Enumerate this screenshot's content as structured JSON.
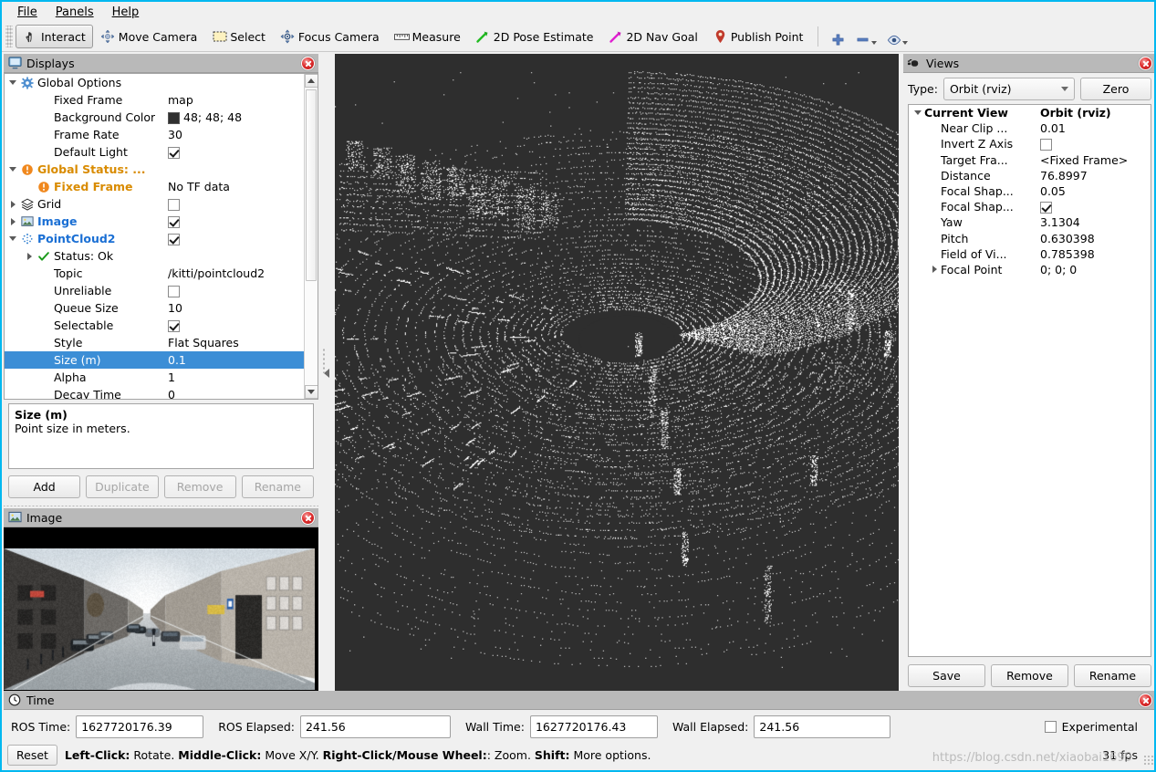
{
  "window": {
    "accent": "#00b8f0"
  },
  "menubar": {
    "items": [
      {
        "name": "file",
        "label": "File",
        "mnemonic": "F"
      },
      {
        "name": "panels",
        "label": "Panels",
        "mnemonic": "P"
      },
      {
        "name": "help",
        "label": "Help",
        "mnemonic": "H"
      }
    ]
  },
  "toolbar": {
    "tools": [
      {
        "name": "interact",
        "label": "Interact",
        "icon": "hand-cursor-icon",
        "active": true
      },
      {
        "name": "move-camera",
        "label": "Move Camera",
        "icon": "move-camera-icon",
        "active": false
      },
      {
        "name": "select",
        "label": "Select",
        "icon": "select-rectangle-icon",
        "active": false
      },
      {
        "name": "focus-camera",
        "label": "Focus Camera",
        "icon": "focus-camera-icon",
        "active": false
      },
      {
        "name": "measure",
        "label": "Measure",
        "icon": "ruler-icon",
        "active": false
      },
      {
        "name": "2d-pose-estimate",
        "label": "2D Pose Estimate",
        "icon": "green-arrow-icon",
        "active": false
      },
      {
        "name": "2d-nav-goal",
        "label": "2D Nav Goal",
        "icon": "magenta-arrow-icon",
        "active": false
      },
      {
        "name": "publish-point",
        "label": "Publish Point",
        "icon": "map-pin-icon",
        "active": false
      }
    ],
    "extras": [
      {
        "name": "add-tool",
        "icon": "plus-icon"
      },
      {
        "name": "remove-tool",
        "icon": "minus-icon"
      },
      {
        "name": "visibility-tool",
        "icon": "eye-icon"
      }
    ]
  },
  "displays": {
    "title": "Displays",
    "title_icon": "monitor-icon",
    "close_icon": "close-icon",
    "rows": [
      {
        "indent": 0,
        "expander": "down",
        "icon": "gear-icon",
        "label": "Global Options",
        "style": "plain",
        "value": "",
        "vtype": "text"
      },
      {
        "indent": 1,
        "expander": "none",
        "icon": "none",
        "label": "Fixed Frame",
        "style": "plain",
        "value": "map",
        "vtype": "text"
      },
      {
        "indent": 1,
        "expander": "none",
        "icon": "none",
        "label": "Background Color",
        "style": "plain",
        "value": "48; 48; 48",
        "vtype": "color",
        "color": "#303030"
      },
      {
        "indent": 1,
        "expander": "none",
        "icon": "none",
        "label": "Frame Rate",
        "style": "plain",
        "value": "30",
        "vtype": "text"
      },
      {
        "indent": 1,
        "expander": "none",
        "icon": "none",
        "label": "Default Light",
        "style": "plain",
        "value": "",
        "vtype": "check",
        "checked": true
      },
      {
        "indent": 0,
        "expander": "down",
        "icon": "warning-icon",
        "label": "Global Status: ...",
        "style": "warn",
        "value": "",
        "vtype": "text"
      },
      {
        "indent": 1,
        "expander": "none",
        "icon": "warning-icon",
        "label": "Fixed Frame",
        "style": "warn",
        "value": "No TF data",
        "vtype": "text"
      },
      {
        "indent": 0,
        "expander": "right",
        "icon": "grid-icon",
        "label": "Grid",
        "style": "plain",
        "value": "",
        "vtype": "check",
        "checked": false
      },
      {
        "indent": 0,
        "expander": "right",
        "icon": "image-icon",
        "label": "Image",
        "style": "active",
        "value": "",
        "vtype": "check",
        "checked": true
      },
      {
        "indent": 0,
        "expander": "down",
        "icon": "pointcloud-icon",
        "label": "PointCloud2",
        "style": "active",
        "value": "",
        "vtype": "check",
        "checked": true
      },
      {
        "indent": 1,
        "expander": "right",
        "icon": "ok-check-icon",
        "label": "Status: Ok",
        "style": "plain",
        "value": "",
        "vtype": "text"
      },
      {
        "indent": 1,
        "expander": "none",
        "icon": "none",
        "label": "Topic",
        "style": "plain",
        "value": "/kitti/pointcloud2",
        "vtype": "text"
      },
      {
        "indent": 1,
        "expander": "none",
        "icon": "none",
        "label": "Unreliable",
        "style": "plain",
        "value": "",
        "vtype": "check",
        "checked": false
      },
      {
        "indent": 1,
        "expander": "none",
        "icon": "none",
        "label": "Queue Size",
        "style": "plain",
        "value": "10",
        "vtype": "text"
      },
      {
        "indent": 1,
        "expander": "none",
        "icon": "none",
        "label": "Selectable",
        "style": "plain",
        "value": "",
        "vtype": "check",
        "checked": true
      },
      {
        "indent": 1,
        "expander": "none",
        "icon": "none",
        "label": "Style",
        "style": "plain",
        "value": "Flat Squares",
        "vtype": "text"
      },
      {
        "indent": 1,
        "expander": "none",
        "icon": "none",
        "label": "Size (m)",
        "style": "plain",
        "value": "0.1",
        "vtype": "text",
        "selected": true
      },
      {
        "indent": 1,
        "expander": "none",
        "icon": "none",
        "label": "Alpha",
        "style": "plain",
        "value": "1",
        "vtype": "text"
      },
      {
        "indent": 1,
        "expander": "none",
        "icon": "none",
        "label": "Decay Time",
        "style": "plain",
        "value": "0",
        "vtype": "text"
      }
    ],
    "description": {
      "title": "Size (m)",
      "text": "Point size in meters."
    },
    "buttons": [
      {
        "name": "add-display-button",
        "label": "Add",
        "enabled": true
      },
      {
        "name": "duplicate-display-button",
        "label": "Duplicate",
        "enabled": false
      },
      {
        "name": "remove-display-button",
        "label": "Remove",
        "enabled": false
      },
      {
        "name": "rename-display-button",
        "label": "Rename",
        "enabled": false
      }
    ]
  },
  "image_panel": {
    "title": "Image",
    "title_icon": "image-icon",
    "close_icon": "close-icon",
    "scene_description": "KITTI street-view camera frame: narrow European city street with parked cars on both sides, row houses, a pedestrian crossing and bright overcast sky at the vanishing point"
  },
  "views": {
    "title": "Views",
    "title_icon": "camera-icon",
    "close_icon": "close-icon",
    "type_label": "Type:",
    "type_value": "Orbit (rviz)",
    "zero_button": "Zero",
    "rows": [
      {
        "indent": 0,
        "expander": "down",
        "label": "Current View",
        "value": "Orbit (rviz)",
        "vtype": "text",
        "bold": true
      },
      {
        "indent": 1,
        "expander": "none",
        "label": "Near Clip ...",
        "value": "0.01",
        "vtype": "text"
      },
      {
        "indent": 1,
        "expander": "none",
        "label": "Invert Z Axis",
        "value": "",
        "vtype": "check",
        "checked": false
      },
      {
        "indent": 1,
        "expander": "none",
        "label": "Target Fra...",
        "value": "<Fixed Frame>",
        "vtype": "text"
      },
      {
        "indent": 1,
        "expander": "none",
        "label": "Distance",
        "value": "76.8997",
        "vtype": "text"
      },
      {
        "indent": 1,
        "expander": "none",
        "label": "Focal Shap...",
        "value": "0.05",
        "vtype": "text"
      },
      {
        "indent": 1,
        "expander": "none",
        "label": "Focal Shap...",
        "value": "",
        "vtype": "check",
        "checked": true
      },
      {
        "indent": 1,
        "expander": "none",
        "label": "Yaw",
        "value": "3.1304",
        "vtype": "text"
      },
      {
        "indent": 1,
        "expander": "none",
        "label": "Pitch",
        "value": "0.630398",
        "vtype": "text"
      },
      {
        "indent": 1,
        "expander": "none",
        "label": "Field of Vi...",
        "value": "0.785398",
        "vtype": "text"
      },
      {
        "indent": 1,
        "expander": "right",
        "label": "Focal Point",
        "value": "0; 0; 0",
        "vtype": "text"
      }
    ],
    "buttons": [
      {
        "name": "save-view-button",
        "label": "Save"
      },
      {
        "name": "remove-view-button",
        "label": "Remove"
      },
      {
        "name": "rename-view-button",
        "label": "Rename"
      }
    ]
  },
  "time_panel": {
    "title": "Time",
    "title_icon": "clock-icon",
    "close_icon": "close-icon",
    "fields": [
      {
        "name": "ros-time",
        "label": "ROS Time:",
        "value": "1627720176.39"
      },
      {
        "name": "ros-elapsed",
        "label": "ROS Elapsed:",
        "value": "241.56"
      },
      {
        "name": "wall-time",
        "label": "Wall Time:",
        "value": "1627720176.43"
      },
      {
        "name": "wall-elapsed",
        "label": "Wall Elapsed:",
        "value": "241.56"
      }
    ],
    "experimental_label": "Experimental",
    "experimental_checked": false,
    "reset_button": "Reset",
    "hint_segments": [
      {
        "text": "Left-Click:",
        "bold": true
      },
      {
        "text": " Rotate. ",
        "bold": false
      },
      {
        "text": "Middle-Click:",
        "bold": true
      },
      {
        "text": " Move X/Y. ",
        "bold": false
      },
      {
        "text": "Right-Click/Mouse Wheel:",
        "bold": true
      },
      {
        "text": ": Zoom. ",
        "bold": false
      },
      {
        "text": "Shift:",
        "bold": true
      },
      {
        "text": " More options.",
        "bold": false
      }
    ],
    "fps": "31 fps",
    "watermark": "https://blog.csdn.net/xiaobai1699"
  },
  "viewport": {
    "background_color": "#2e2e2e",
    "point_color": "#ffffff",
    "content_description": "White LiDAR point cloud of a street scene rendered as flat squares; concentric scan rings radiate from the sensor origin with a dark ego-vehicle shadow at center, building facades at left and upper right, and road surface rings extending toward the bottom"
  }
}
